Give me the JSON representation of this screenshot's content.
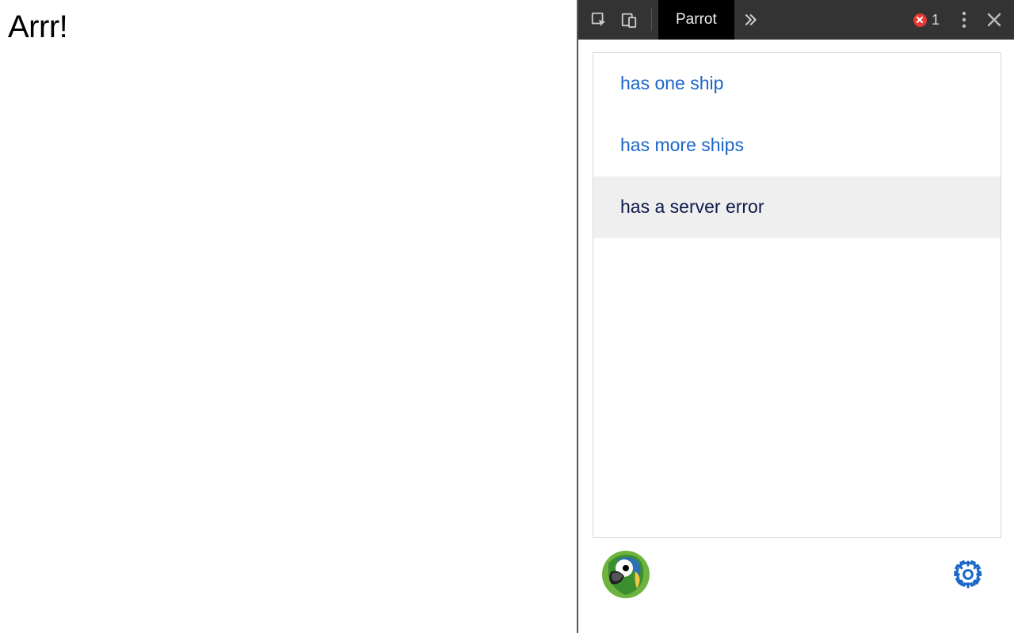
{
  "page": {
    "heading": "Arrr!"
  },
  "devtools": {
    "tab_label": "Parrot",
    "error_count": "1",
    "scenarios": [
      {
        "label": "has one ship",
        "selected": false
      },
      {
        "label": "has more ships",
        "selected": false
      },
      {
        "label": "has a server error",
        "selected": true
      }
    ],
    "icons": {
      "inspect": "inspect-icon",
      "device": "device-icon",
      "more_tabs": "chevron-double-right-icon",
      "kebab": "kebab-icon",
      "close": "close-icon",
      "error": "error-icon",
      "logo": "parrot-icon",
      "settings": "gear-icon"
    }
  }
}
